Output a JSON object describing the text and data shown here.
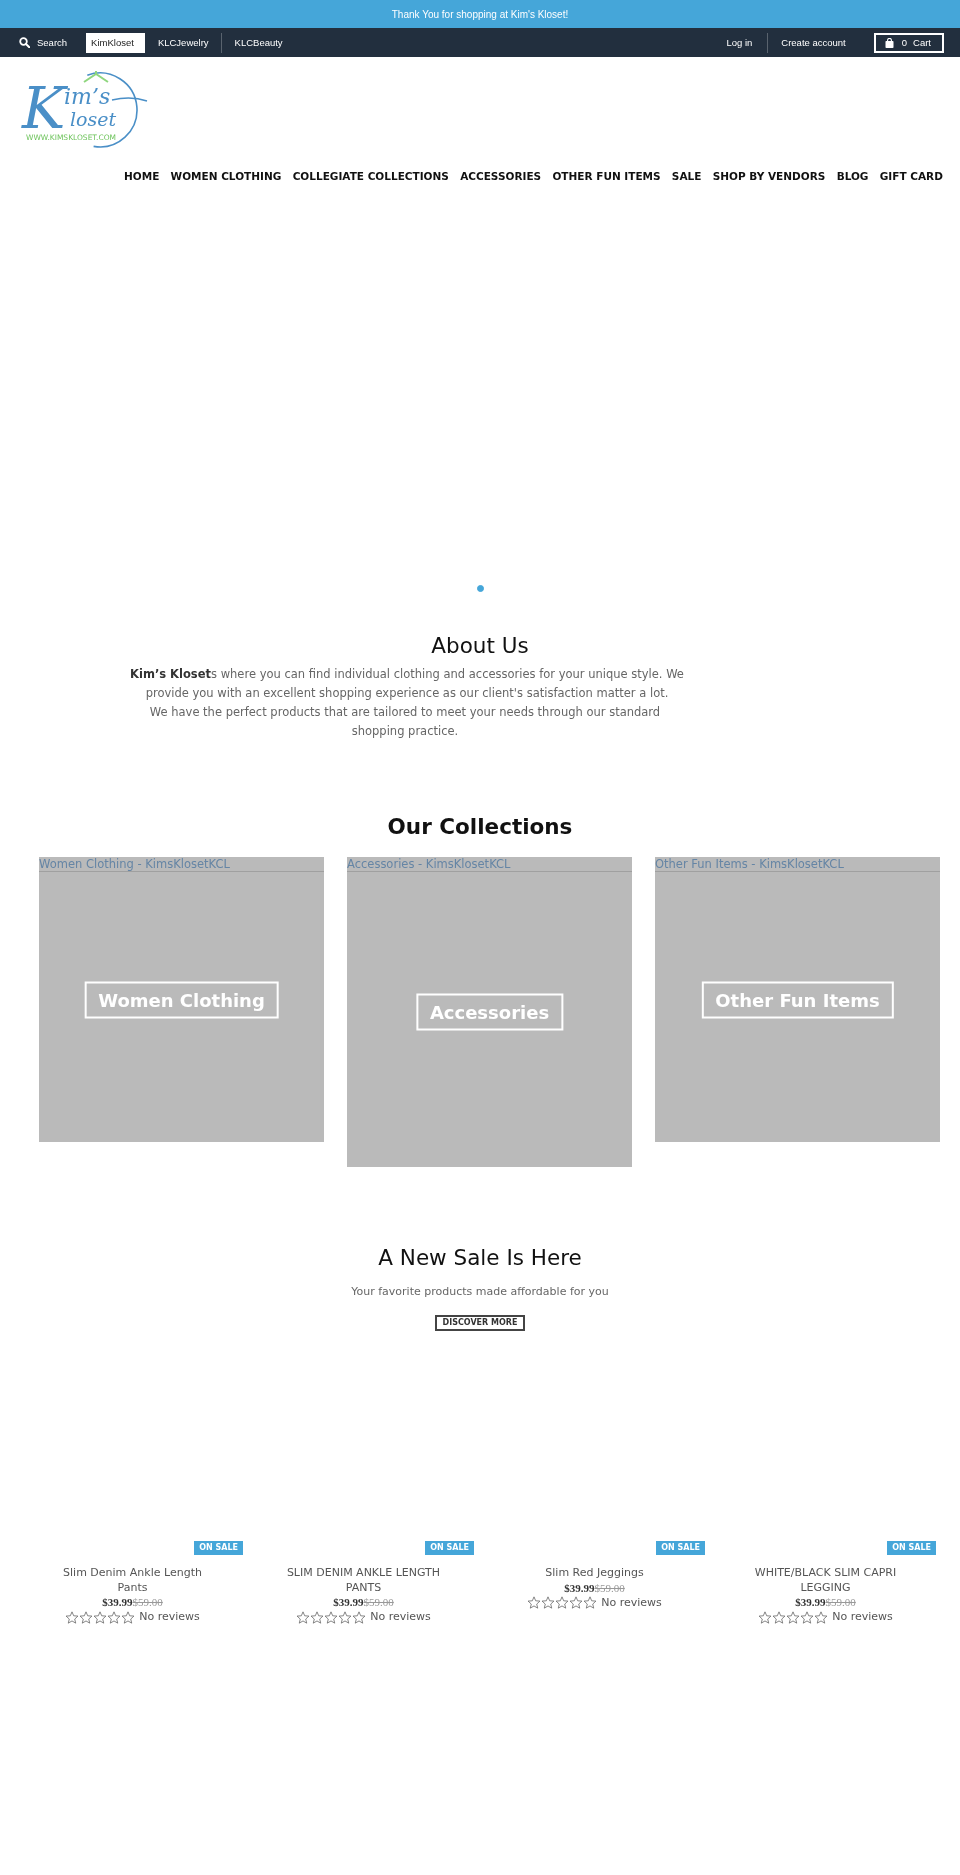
{
  "announcement": {
    "text": "Thank You for shopping at Kim's Kloset!"
  },
  "top_bar": {
    "search": {
      "label": "Search"
    },
    "stores": [
      {
        "label": "KimKloset",
        "selected": true
      },
      {
        "label": "KLCJewelry",
        "selected": false
      },
      {
        "label": "KLCBeauty",
        "selected": false
      }
    ],
    "account_links": [
      {
        "label": "Log in"
      },
      {
        "label": "Create account"
      }
    ],
    "cart": {
      "count": "0",
      "label": "Cart"
    }
  },
  "logo": {
    "initial": "K",
    "first_word": "im’s",
    "second_word": "loset",
    "website": "WWW.KIMSKLOSET.COM"
  },
  "nav": {
    "items": [
      {
        "label": "HOME"
      },
      {
        "label": "WOMEN CLOTHING"
      },
      {
        "label": "COLLEGIATE COLLECTIONS"
      },
      {
        "label": "ACCESSORIES"
      },
      {
        "label": "OTHER FUN ITEMS"
      },
      {
        "label": "SALE"
      },
      {
        "label": "SHOP BY VENDORS"
      },
      {
        "label": "BLOG"
      },
      {
        "label": "GIFT CARD"
      }
    ]
  },
  "slideshow": {
    "dots": [
      {
        "selected": true
      }
    ]
  },
  "about": {
    "title": "About Us",
    "paragraphs": [
      "**Kim’s Kloset**s where you can find individual clothing and accessories for your unique style. We provide you with an excellent shopping experience as our client's satisfaction matter a lot.",
      "We have the perfect products that are tailored to meet your needs through our standard shopping practice."
    ]
  },
  "collections": {
    "title": "Our Collections",
    "items": [
      {
        "alt_text": "Women Clothing - KimsKlosetKCL",
        "label": "Women Clothing"
      },
      {
        "alt_text": "Accessories - KimsKlosetKCL",
        "label": "Accessories"
      },
      {
        "alt_text": "Other Fun Items - KimsKlosetKCL",
        "label": "Other Fun Items"
      }
    ]
  },
  "sale": {
    "title": "A New Sale Is Here",
    "subtitle": "Your favorite products made affordable for you",
    "button": "DISCOVER MORE"
  },
  "products": [
    {
      "badge": "ON SALE",
      "title": "Slim Denim Ankle Length Pants",
      "price": "$39.99",
      "original_price": "$59.00",
      "stars": 0,
      "reviews": "No reviews"
    },
    {
      "badge": "ON SALE",
      "title": "SLIM DENIM ANKLE LENGTH PANTS",
      "price": "$39.99",
      "original_price": "$59.00",
      "stars": 0,
      "reviews": "No reviews"
    },
    {
      "badge": "ON SALE",
      "title": "Slim Red Jeggings",
      "price": "$39.99",
      "original_price": "$59.00",
      "stars": 0,
      "reviews": "No reviews"
    },
    {
      "badge": "ON SALE",
      "title": "WHITE/BLACK SLIM CAPRI LEGGING",
      "price": "$39.99",
      "original_price": "$59.00",
      "stars": 0,
      "reviews": "No reviews"
    }
  ]
}
